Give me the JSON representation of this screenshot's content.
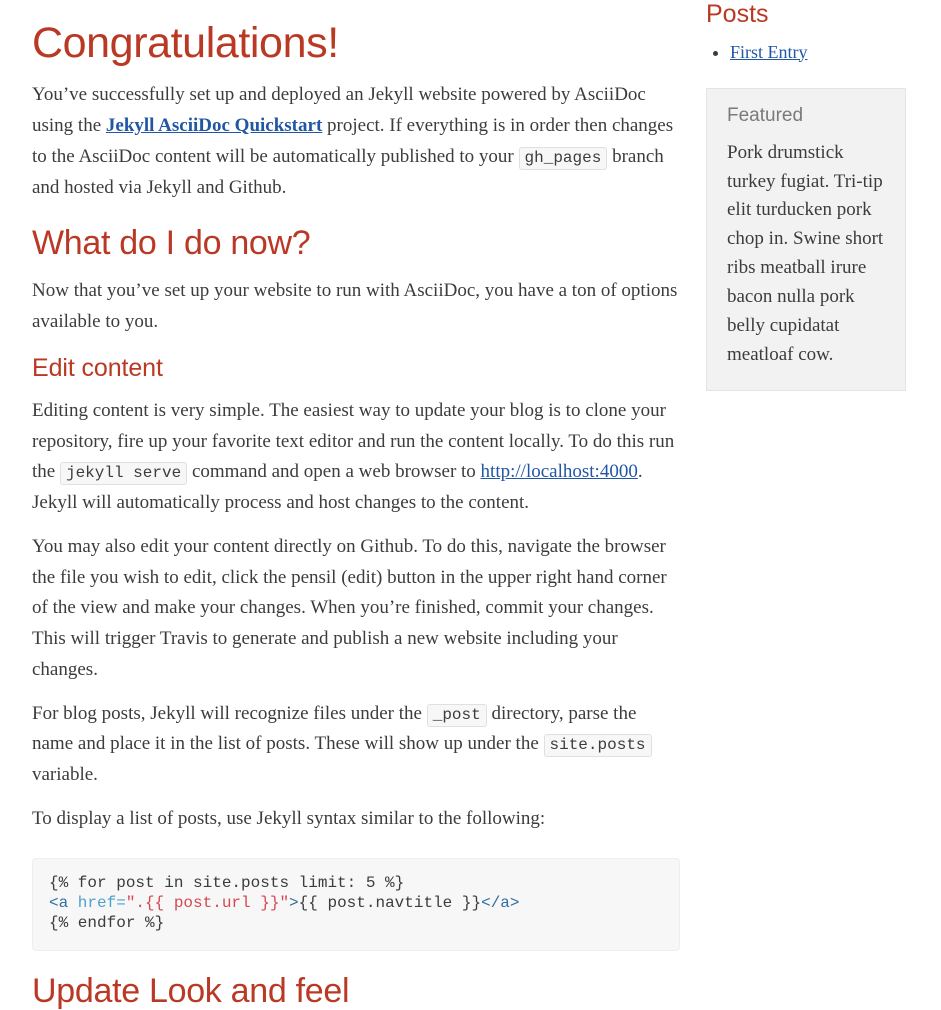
{
  "theme": {
    "heading_color": "#ba3925",
    "body_text_color": "#3c3c3c",
    "link_color": "#2156a5",
    "code_bg": "#f7f7f8",
    "sidebar_box_bg": "#f2f2f2",
    "muted_text_color": "#7a7a7a"
  },
  "main": {
    "title": "Congratulations!",
    "intro": {
      "part1": "You’ve successfully set up and deployed an Jekyll website powered by AsciiDoc using the ",
      "link_label": "Jekyll AsciiDoc Quickstart",
      "part2": " project. If everything is in order then changes to the AsciiDoc content will be automatically published to your ",
      "code": "gh_pages",
      "part3": " branch and hosted via Jekyll and Github."
    },
    "section_what_now": {
      "heading": "What do I do now?",
      "paragraph": "Now that you’ve set up your website to run with AsciiDoc, you have a ton of options available to you."
    },
    "section_edit_content": {
      "heading": "Edit content",
      "p1": {
        "part1": "Editing content is very simple. The easiest way to update your blog is to clone your repository, fire up your favorite text editor and run the content locally. To do this run the ",
        "code": "jekyll serve",
        "part2": " command and open a web browser to ",
        "link_label": "http://localhost:4000",
        "part3": ". Jekyll will automatically process and host changes to the content."
      },
      "p2": "You may also edit your content directly on Github. To do this, navigate the browser the file you wish to edit, click the pensil (edit) button in the upper right hand corner of the view and make your changes. When you’re finished, commit your changes. This will trigger Travis to generate and publish a new website including your changes.",
      "p3": {
        "part1": "For blog posts, Jekyll will recognize files under the ",
        "code1": "_post",
        "part2": " directory, parse the name and place it in the list of posts. These will show up under the ",
        "code2": "site.posts",
        "part3": " variable."
      },
      "p4": "To display a list of posts, use Jekyll syntax similar to the following:",
      "code_block": {
        "line1": "{% for post in site.posts limit: 5 %}",
        "line2_tag_open": "<a",
        "line2_attr": " href=",
        "line2_string": "\".{{ post.url }}\"",
        "line2_gt": ">",
        "line2_rest": "{{ post.navtitle }}",
        "line2_tag_close": "</a>",
        "line3": "{% endfor %}"
      }
    },
    "section_look_feel": {
      "heading": "Update Look and feel"
    }
  },
  "sidebar": {
    "posts_heading": "Posts",
    "posts": [
      {
        "label": "First Entry"
      }
    ],
    "featured": {
      "title": "Featured",
      "body": "Pork drumstick turkey fugiat. Tri-tip elit turducken pork chop in. Swine short ribs meatball irure bacon nulla pork belly cupidatat meatloaf cow."
    }
  }
}
